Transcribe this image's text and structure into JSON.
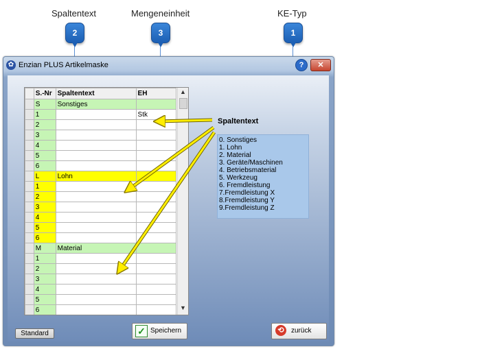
{
  "callouts": [
    {
      "title": "Spaltentext",
      "badge": "2"
    },
    {
      "title": "Mengeneinheit",
      "badge": "3"
    },
    {
      "title": "KE-Typ",
      "badge": "1"
    }
  ],
  "window": {
    "title": "Enzian PLUS Artikelmaske",
    "help_label": "?",
    "close_label": "✕"
  },
  "grid": {
    "headers": [
      "S.-Nr",
      "Spaltentext",
      "EH"
    ],
    "rows": [
      {
        "nr": "S",
        "text": "Sonstiges",
        "eh": "",
        "color": "#c6f5b5"
      },
      {
        "nr": "1",
        "text": "",
        "eh": "Stk",
        "color": "#c6f5b5"
      },
      {
        "nr": "2",
        "text": "",
        "eh": "",
        "color": "#c6f5b5"
      },
      {
        "nr": "3",
        "text": "",
        "eh": "",
        "color": "#c6f5b5"
      },
      {
        "nr": "4",
        "text": "",
        "eh": "",
        "color": "#c6f5b5"
      },
      {
        "nr": "5",
        "text": "",
        "eh": "",
        "color": "#c6f5b5"
      },
      {
        "nr": "6",
        "text": "",
        "eh": "",
        "color": "#c6f5b5"
      },
      {
        "nr": "L",
        "text": "Lohn",
        "eh": "",
        "color": "#ffff00"
      },
      {
        "nr": "1",
        "text": "",
        "eh": "",
        "color": "#ffff00"
      },
      {
        "nr": "2",
        "text": "",
        "eh": "",
        "color": "#ffff00"
      },
      {
        "nr": "3",
        "text": "",
        "eh": "",
        "color": "#ffff00"
      },
      {
        "nr": "4",
        "text": "",
        "eh": "",
        "color": "#ffff00"
      },
      {
        "nr": "5",
        "text": "",
        "eh": "",
        "color": "#ffff00"
      },
      {
        "nr": "6",
        "text": "",
        "eh": "",
        "color": "#ffff00"
      },
      {
        "nr": "M",
        "text": "Material",
        "eh": "",
        "color": "#c6f5b5"
      },
      {
        "nr": "1",
        "text": "",
        "eh": "",
        "color": "#c6f5b5"
      },
      {
        "nr": "2",
        "text": "",
        "eh": "",
        "color": "#c6f5b5"
      },
      {
        "nr": "3",
        "text": "",
        "eh": "",
        "color": "#c6f5b5"
      },
      {
        "nr": "4",
        "text": "",
        "eh": "",
        "color": "#c6f5b5"
      },
      {
        "nr": "5",
        "text": "",
        "eh": "",
        "color": "#c6f5b5"
      },
      {
        "nr": "6",
        "text": "",
        "eh": "",
        "color": "#c6f5b5"
      }
    ]
  },
  "ke_panel": {
    "heading": "Spaltentext",
    "items": [
      "0. Sonstiges",
      "1. Lohn",
      "2. Material",
      "3. Geräte/Maschinen",
      "4. Betriebsmaterial",
      "5. Werkzeug",
      "6. Fremdleistung",
      "7.Fremdleistung X",
      "8.Fremdleistung Y",
      "9.Fremdleistung Z"
    ]
  },
  "buttons": {
    "standard": "Standard",
    "save": "Speichern",
    "back": "zurück"
  },
  "colors": {
    "group_green": "#c6f5b5",
    "group_yellow": "#ffff00",
    "badge_blue": "#2a72cc",
    "arrow_yellow": "#ffee00"
  }
}
